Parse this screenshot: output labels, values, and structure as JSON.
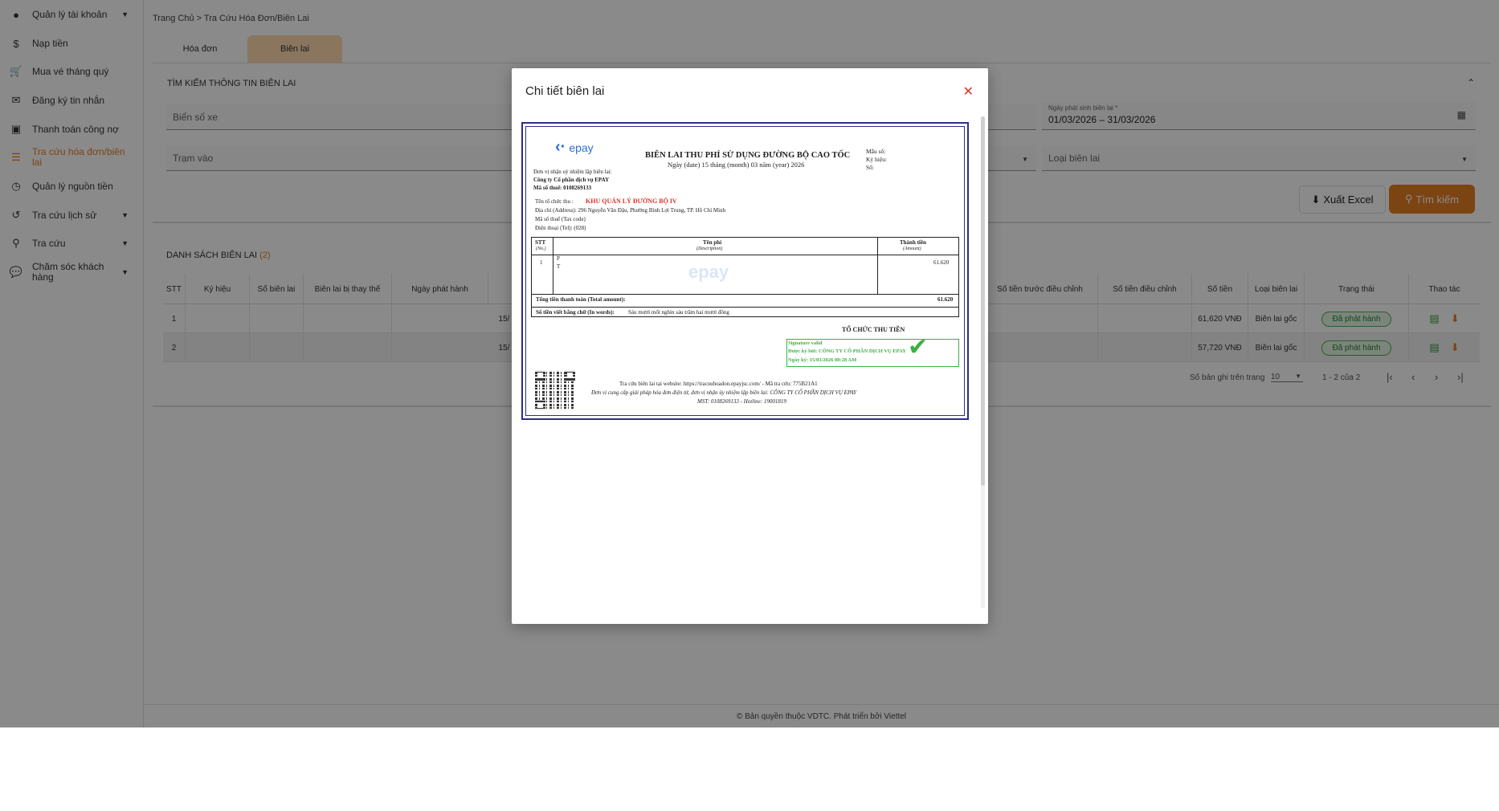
{
  "sidebar": {
    "items": [
      {
        "label": "Quản lý tài khoản",
        "icon": "account-circle-icon",
        "caret": true
      },
      {
        "label": "Nạp tiền",
        "icon": "dollar-icon",
        "caret": false
      },
      {
        "label": "Mua vé tháng quý",
        "icon": "cart-icon",
        "caret": false
      },
      {
        "label": "Đăng ký tin nhắn",
        "icon": "mail-icon",
        "caret": false
      },
      {
        "label": "Thanh toán công nợ",
        "icon": "wallet-icon",
        "caret": false
      },
      {
        "label": "Tra cứu hóa đơn/biên lai",
        "icon": "list-icon",
        "caret": false
      },
      {
        "label": "Quản lý nguồn tiền",
        "icon": "clock-icon",
        "caret": false
      },
      {
        "label": "Tra cứu lịch sử",
        "icon": "history-icon",
        "caret": true
      },
      {
        "label": "Tra cứu",
        "icon": "search-icon",
        "caret": true
      },
      {
        "label": "Chăm sóc khách hàng",
        "icon": "chat-icon",
        "caret": true
      }
    ]
  },
  "breadcrumb": {
    "home": "Trang Chủ",
    "sep": ">",
    "current": "Tra Cứu Hóa Đơn/Biên Lai"
  },
  "tabs": [
    {
      "label": "Hóa đơn"
    },
    {
      "label": "Biên lai"
    }
  ],
  "search": {
    "title": "TÌM KIẾM THÔNG TIN BIÊN LAI",
    "plate_placeholder": "Biển số xe",
    "station_placeholder": "Trạm vào",
    "date_label": "Ngày phát sinh biên lai *",
    "date_value": "01/03/2026 – 31/03/2026",
    "receipt_type_placeholder": "Loại biên lai",
    "excel_label": "Xuất Excel",
    "search_label": "Tìm kiếm"
  },
  "list": {
    "title": "DANH SÁCH BIÊN LAI",
    "count": "(2)",
    "headers": [
      "STT",
      "Ký hiệu",
      "Số biên lai",
      "Biên lai bị thay thế",
      "Ngày phát hành",
      "Số tiền trước điều chỉnh",
      "Số tiền điều chỉnh",
      "Số tiền",
      "Loại biên lai",
      "Trạng thái",
      "Thao tác"
    ],
    "rows": [
      {
        "stt": "1",
        "date_partial": "15/",
        "amount": "61,620 VNĐ",
        "type": "Biên lai gốc",
        "status": "Đã phát hành"
      },
      {
        "stt": "2",
        "date_partial": "15/",
        "amount": "57,720 VNĐ",
        "type": "Biên lai gốc",
        "status": "Đã phát hành"
      }
    ],
    "pager": {
      "per_page_label": "Số bản ghi trên trang",
      "per_page": "10",
      "range": "1 - 2 của 2"
    }
  },
  "footer": {
    "text": "© Bản quyền thuộc VDTC. Phát triển bởi Viettel"
  },
  "modal": {
    "title": "Chi tiết biên lai",
    "receipt": {
      "logo_text": "epay",
      "title": "BIÊN LAI THU PHÍ SỬ DỤNG ĐƯỜNG BỘ CAO TỐC",
      "date_line": "Ngày (date) 15 tháng (month) 03 năm (year) 2026",
      "form_label": "Mẫu số:",
      "symbol_label": "Ký hiệu:",
      "number_label": "Số:",
      "unit_label": "Đơn vị nhận uỷ nhiệm lập biên lai:",
      "unit_name": "Công ty Cổ phần dịch vụ EPAY",
      "unit_tax": "Mã số thuế: 0108269133",
      "collector_label": "Tên tổ chức thu :",
      "collector_name": "KHU QUẢN LÝ ĐƯỜNG BỘ IV",
      "address": "Địa chỉ (Address): 296 Nguyễn Văn Đậu, Phường Bình Lợi Trung, TP. Hồ Chí Minh",
      "tax_code": "Mã số thuế (Tax code)",
      "phone": "Điện thoại (Tel): (028)",
      "th_stt": "STT",
      "th_stt_en": "(No.)",
      "th_fee": "Tên phí",
      "th_fee_en": "(Description)",
      "th_amount": "Thành tiền",
      "th_amount_en": "(Amount)",
      "row_stt": "1",
      "row_line1": "P",
      "row_line2": "T",
      "row_amount": "61.620",
      "total_label": "Tổng tiền thanh toán (Total amount):",
      "total_value": "61.620",
      "words_label": "Số tiền viết bằng chữ (In words):",
      "words_value": "Sáu mươi mốt nghìn sáu trăm hai mươi đồng",
      "org_label": "TỔ CHỨC THU TIỀN",
      "sig_valid": "Signature valid",
      "sig_by": "Được ký bởi: CÔNG TY CỔ PHẦN DỊCH VỤ EPAY",
      "sig_date": "Ngày ký: 15/03/2026 08:28 AM",
      "lookup_line": "Tra cứu biên lai tại website: https://tracuuhoadon.epayjsc.com/ - Mã tra cứu: 775B21A1",
      "provider_line": "Đơn vị cung cấp giải pháp hóa đơn điện tử, đơn vị nhận ủy nhiệm lập biên lai: CÔNG TY CỔ PHẦN DỊCH VỤ EPAY",
      "mst_line": "MST: 0108269133 - Hotline: 19001819",
      "watermark": "epay"
    }
  },
  "colors": {
    "accent": "#e67e22",
    "tab_active": "#ffd9b0",
    "status_green": "#2e7d32",
    "receipt_border": "#2d2d8e",
    "signature_green": "#3cb043",
    "collector_red": "#d9342b"
  }
}
